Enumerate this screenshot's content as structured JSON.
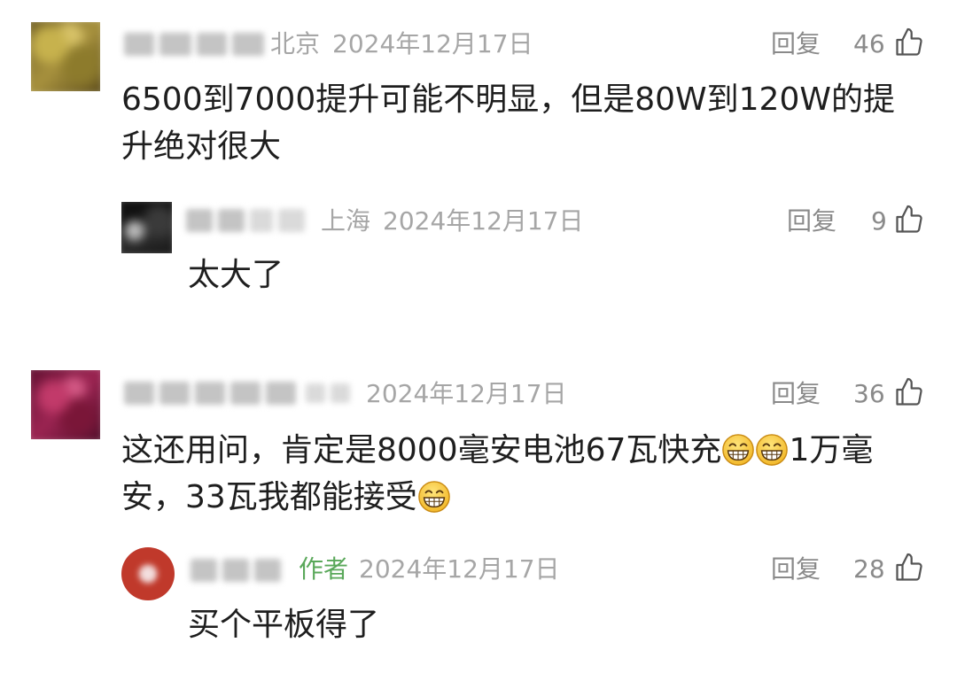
{
  "colors": {
    "author_badge": "#5aa85a",
    "meta_text": "#a6a6a6",
    "body_text": "#1e1e1e"
  },
  "comments": [
    {
      "location": "北京",
      "date": "2024年12月17日",
      "reply_label": "回复",
      "likes": 46,
      "like_icon": "thumbs-up-icon",
      "text_lines": [
        "6500到7000提升可能不明显，但是80W到120W的提",
        "升绝对很大"
      ],
      "replies": [
        {
          "location": "上海",
          "date": "2024年12月17日",
          "reply_label": "回复",
          "likes": 9,
          "like_icon": "thumbs-up-icon",
          "text_lines": [
            "太大了"
          ]
        }
      ]
    },
    {
      "date": "2024年12月17日",
      "reply_label": "回复",
      "likes": 36,
      "like_icon": "thumbs-up-icon",
      "text_lines": [
        {
          "parts": [
            {
              "text": "这还用问，肯定是8000毫安电池67瓦快充"
            },
            {
              "emoji": "grinning-face"
            },
            {
              "emoji": "grinning-face"
            },
            {
              "text": "1万毫"
            }
          ]
        },
        {
          "parts": [
            {
              "text": "安，33瓦我都能接受"
            },
            {
              "emoji": "grinning-face"
            }
          ]
        }
      ],
      "replies": [
        {
          "badge": "作者",
          "date": "2024年12月17日",
          "reply_label": "回复",
          "likes": 28,
          "like_icon": "thumbs-up-icon",
          "text_lines": [
            "买个平板得了"
          ]
        }
      ]
    }
  ]
}
